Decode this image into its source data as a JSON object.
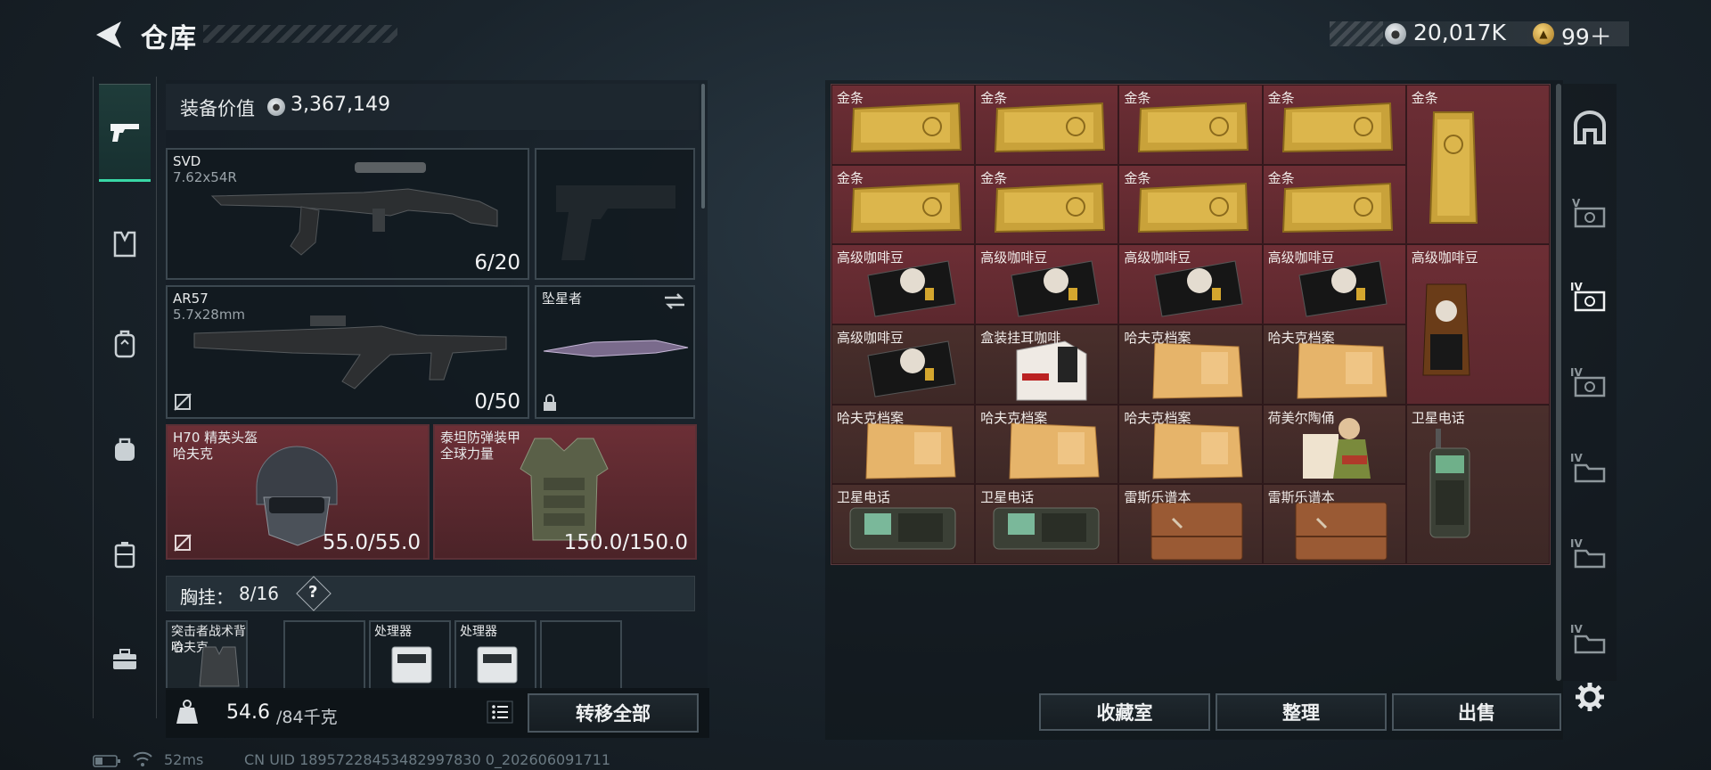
{
  "header": {
    "title": "仓库",
    "currency_silver": "20,017K",
    "currency_gold": "99＋"
  },
  "left_nav": [
    "weapon-icon",
    "armor-icon",
    "backpack-icon",
    "bag-icon",
    "case-icon",
    "toolbox-icon"
  ],
  "loadout": {
    "value_label": "装备价值",
    "value": "3,367,149",
    "primary": {
      "name": "SVD",
      "caliber": "7.62x54R",
      "ammo": "6/20"
    },
    "secondary": {
      "name": "AR57",
      "caliber": "5.7x28mm",
      "ammo": "0/50"
    },
    "melee": {
      "name": "坠星者"
    },
    "helmet": {
      "name": "H70 精英头盔",
      "brand": "哈夫克",
      "durability": "55.0/55.0"
    },
    "armor": {
      "name": "泰坦防弹装甲",
      "brand": "全球力量",
      "durability": "150.0/150.0"
    },
    "vest_label": "胸挂：",
    "vest_capacity": "8/16",
    "vest_help": "?",
    "vest_slots": [
      {
        "name": "突击者战术背心",
        "brand": "哈夫克"
      },
      {
        "name": ""
      },
      {
        "name": "处理器"
      },
      {
        "name": "处理器"
      },
      {
        "name": ""
      }
    ],
    "weight": "54.6",
    "weight_max": "/84千克",
    "transfer_all": "转移全部"
  },
  "inventory": {
    "items": [
      {
        "label": "金条",
        "type": "gold"
      },
      {
        "label": "金条",
        "type": "gold"
      },
      {
        "label": "金条",
        "type": "gold"
      },
      {
        "label": "金条",
        "type": "gold"
      },
      {
        "label": "金条",
        "type": "gold-v"
      },
      {
        "label": "金条",
        "type": "gold"
      },
      {
        "label": "金条",
        "type": "gold"
      },
      {
        "label": "金条",
        "type": "gold"
      },
      {
        "label": "金条",
        "type": "gold"
      },
      {
        "label": "",
        "type": "empty"
      },
      {
        "label": "高级咖啡豆",
        "type": "coffee"
      },
      {
        "label": "高级咖啡豆",
        "type": "coffee"
      },
      {
        "label": "高级咖啡豆",
        "type": "coffee"
      },
      {
        "label": "高级咖啡豆",
        "type": "coffee"
      },
      {
        "label": "高级咖啡豆",
        "type": "coffee-v"
      },
      {
        "label": "高级咖啡豆",
        "type": "coffee"
      },
      {
        "label": "盒装挂耳咖啡",
        "type": "box"
      },
      {
        "label": "哈夫克档案",
        "type": "file"
      },
      {
        "label": "哈夫克档案",
        "type": "file"
      },
      {
        "label": "",
        "type": "empty"
      },
      {
        "label": "哈夫克档案",
        "type": "file"
      },
      {
        "label": "哈夫克档案",
        "type": "file"
      },
      {
        "label": "哈夫克档案",
        "type": "file"
      },
      {
        "label": "荷美尔陶俑",
        "type": "figure"
      },
      {
        "label": "卫星电话",
        "type": "phone-v"
      },
      {
        "label": "卫星电话",
        "type": "radio"
      },
      {
        "label": "卫星电话",
        "type": "radio"
      },
      {
        "label": "雷斯乐谱本",
        "type": "book"
      },
      {
        "label": "雷斯乐谱本",
        "type": "book"
      },
      {
        "label": "",
        "type": "empty"
      }
    ],
    "collection_button": "收藏室",
    "sort_button": "整理",
    "sell_button": "出售"
  },
  "right_nav": [
    "home-icon",
    "storage-tier-v-icon",
    "storage-tier-iv-icon",
    "storage-tier-iv-icon",
    "storage-tier-iv-icon",
    "storage-tier-iv-icon",
    "storage-tier-iv-icon"
  ],
  "status": {
    "ping": "52ms",
    "uid": "CN UID 18957228453482997830 0_202606091711"
  }
}
